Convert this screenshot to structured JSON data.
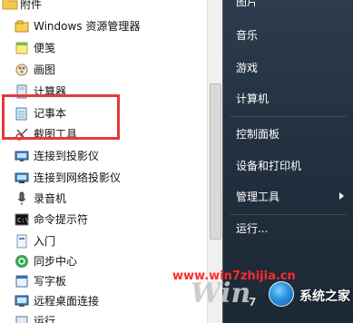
{
  "programs": {
    "folder_label": "附件",
    "items": [
      {
        "label": "Windows 资源管理器",
        "icon": "folder-explorer-icon"
      },
      {
        "label": "便笺",
        "icon": "sticky-notes-icon"
      },
      {
        "label": "画图",
        "icon": "paint-icon"
      },
      {
        "label": "计算器",
        "icon": "calculator-icon"
      },
      {
        "label": "记事本",
        "icon": "notepad-icon"
      },
      {
        "label": "截图工具",
        "icon": "snipping-tool-icon"
      },
      {
        "label": "连接到投影仪",
        "icon": "projector-icon"
      },
      {
        "label": "连接到网络投影仪",
        "icon": "network-projector-icon"
      },
      {
        "label": "录音机",
        "icon": "microphone-icon"
      },
      {
        "label": "命令提示符",
        "icon": "command-prompt-icon"
      },
      {
        "label": "入门",
        "icon": "getting-started-icon"
      },
      {
        "label": "同步中心",
        "icon": "sync-center-icon"
      },
      {
        "label": "写字板",
        "icon": "wordpad-icon"
      },
      {
        "label": "远程桌面连接",
        "icon": "remote-desktop-icon"
      },
      {
        "label": "运行",
        "icon": "run-icon"
      }
    ]
  },
  "right_menu": {
    "items": [
      {
        "label": "图片"
      },
      {
        "label": "音乐"
      },
      {
        "label": "游戏"
      },
      {
        "label": "计算机"
      },
      {
        "label": "控制面板"
      },
      {
        "label": "设备和打印机"
      },
      {
        "label": "管理工具"
      },
      {
        "label": "运行..."
      }
    ]
  },
  "watermark": {
    "url": "www.win7zhijia.cn",
    "logo": "Win",
    "logo_seven": "7",
    "brand": "系统之家"
  },
  "colors": {
    "highlight_box": "#e53a3a",
    "right_panel": "#22303f",
    "watermark_url": "#ff2a2a"
  }
}
